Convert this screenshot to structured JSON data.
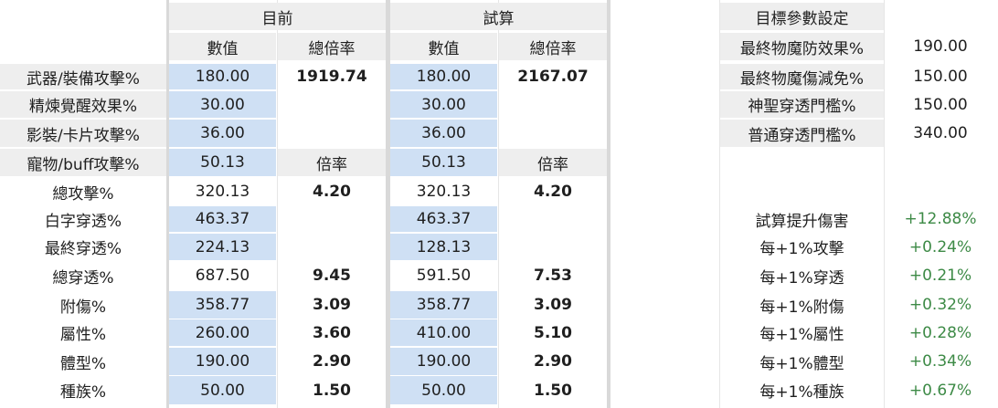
{
  "header": {
    "current": "目前",
    "trial": "試算",
    "value": "數值",
    "total_multiplier": "總倍率",
    "target_params": "目標參數設定"
  },
  "multiplier_label": "倍率",
  "rows": [
    {
      "label": "武器/裝備攻擊%",
      "cur": "180.00",
      "cur_mult": "1919.74",
      "trial": "180.00",
      "trial_mult": "2167.07"
    },
    {
      "label": "精煉覺醒效果%",
      "cur": "30.00",
      "cur_mult": "",
      "trial": "30.00",
      "trial_mult": ""
    },
    {
      "label": "影裝/卡片攻擊%",
      "cur": "36.00",
      "cur_mult": "",
      "trial": "36.00",
      "trial_mult": ""
    },
    {
      "label": "寵物/buff攻擊%",
      "cur": "50.13",
      "cur_mult": "倍率",
      "trial": "50.13",
      "trial_mult": "倍率"
    },
    {
      "label": "總攻擊%",
      "cur": "320.13",
      "cur_mult": "4.20",
      "trial": "320.13",
      "trial_mult": "4.20"
    },
    {
      "label": "白字穿透%",
      "cur": "463.37",
      "cur_mult": "",
      "trial": "463.37",
      "trial_mult": ""
    },
    {
      "label": "最終穿透%",
      "cur": "224.13",
      "cur_mult": "",
      "trial": "128.13",
      "trial_mult": ""
    },
    {
      "label": "總穿透%",
      "cur": "687.50",
      "cur_mult": "9.45",
      "trial": "591.50",
      "trial_mult": "7.53"
    },
    {
      "label": "附傷%",
      "cur": "358.77",
      "cur_mult": "3.09",
      "trial": "358.77",
      "trial_mult": "3.09"
    },
    {
      "label": "屬性%",
      "cur": "260.00",
      "cur_mult": "3.60",
      "trial": "410.00",
      "trial_mult": "5.10"
    },
    {
      "label": "體型%",
      "cur": "190.00",
      "cur_mult": "2.90",
      "trial": "190.00",
      "trial_mult": "2.90"
    },
    {
      "label": "種族%",
      "cur": "50.00",
      "cur_mult": "1.50",
      "trial": "50.00",
      "trial_mult": "1.50"
    }
  ],
  "targets": [
    {
      "label": "最終物魔防效果%",
      "value": "190.00"
    },
    {
      "label": "最終物魔傷減免%",
      "value": "150.00"
    },
    {
      "label": "神聖穿透門檻%",
      "value": "150.00"
    },
    {
      "label": "普通穿透門檻%",
      "value": "340.00"
    }
  ],
  "results": [
    {
      "label": "試算提升傷害",
      "value": "+12.88%"
    },
    {
      "label": "每+1%攻擊",
      "value": "+0.24%"
    },
    {
      "label": "每+1%穿透",
      "value": "+0.21%"
    },
    {
      "label": "每+1%附傷",
      "value": "+0.32%"
    },
    {
      "label": "每+1%屬性",
      "value": "+0.28%"
    },
    {
      "label": "每+1%體型",
      "value": "+0.34%"
    },
    {
      "label": "每+1%種族",
      "value": "+0.67%"
    }
  ],
  "colors": {
    "header_bg": "#eeeeee",
    "input_bg": "#cfe0f4",
    "positive_text": "#3d8a46"
  }
}
